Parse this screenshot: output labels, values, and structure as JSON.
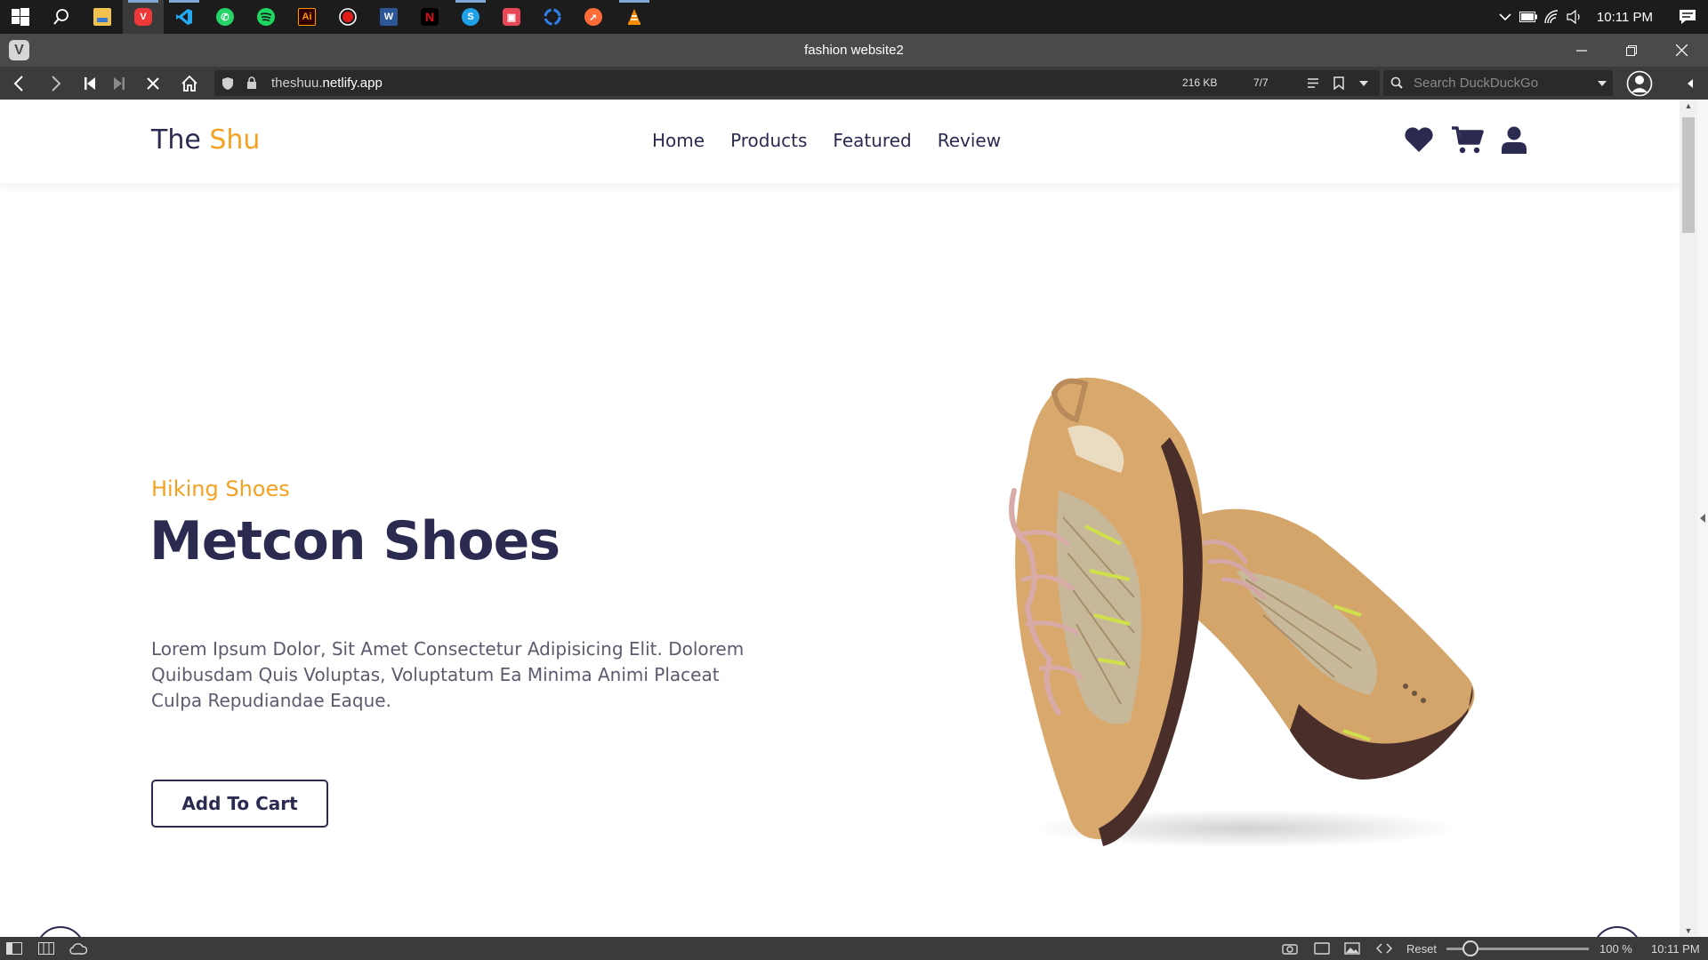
{
  "taskbar": {
    "apps": [
      {
        "name": "start",
        "icon": "windows-logo-icon"
      },
      {
        "name": "search",
        "icon": "search-icon"
      },
      {
        "name": "file-explorer",
        "icon": "folder-icon"
      },
      {
        "name": "vivaldi",
        "icon": "vivaldi-icon"
      },
      {
        "name": "vscode",
        "icon": "vscode-icon"
      },
      {
        "name": "whatsapp",
        "icon": "whatsapp-icon"
      },
      {
        "name": "spotify",
        "icon": "spotify-icon"
      },
      {
        "name": "illustrator",
        "icon": "illustrator-icon",
        "label": "Ai"
      },
      {
        "name": "recorder",
        "icon": "record-icon"
      },
      {
        "name": "word",
        "icon": "word-icon",
        "label": "W"
      },
      {
        "name": "netflix",
        "icon": "netflix-icon",
        "label": "N"
      },
      {
        "name": "skype",
        "icon": "skype-icon",
        "label": "S"
      },
      {
        "name": "photos",
        "icon": "photos-icon"
      },
      {
        "name": "recycle",
        "icon": "recycle-icon"
      },
      {
        "name": "postman",
        "icon": "postman-icon"
      },
      {
        "name": "vlc",
        "icon": "vlc-icon"
      }
    ],
    "clock": "10:11 PM"
  },
  "browser": {
    "window_title": "fashion website2",
    "url_host": "theshuu.",
    "url_domain": "netlify.app",
    "page_size": "216 KB",
    "loaded": "7/7",
    "search_placeholder": "Search DuckDuckGo"
  },
  "site": {
    "logo_main": "The ",
    "logo_accent": "Shu",
    "nav": [
      "Home",
      "Products",
      "Featured",
      "Review"
    ],
    "hero": {
      "eyebrow": "Hiking Shoes",
      "title": "Metcon Shoes",
      "description": "Lorem Ipsum Dolor, Sit Amet Consectetur Adipisicing Elit. Dolorem Quibusdam Quis Voluptas, Voluptatum Ea Minima Animi Placeat Culpa Repudiandae Eaque.",
      "cta": "Add To Cart"
    },
    "colors": {
      "brand": "#2b2b52",
      "accent": "#f4a223"
    }
  },
  "statusbar": {
    "reset": "Reset",
    "zoom": "100 %",
    "clock": "10:11 PM"
  }
}
